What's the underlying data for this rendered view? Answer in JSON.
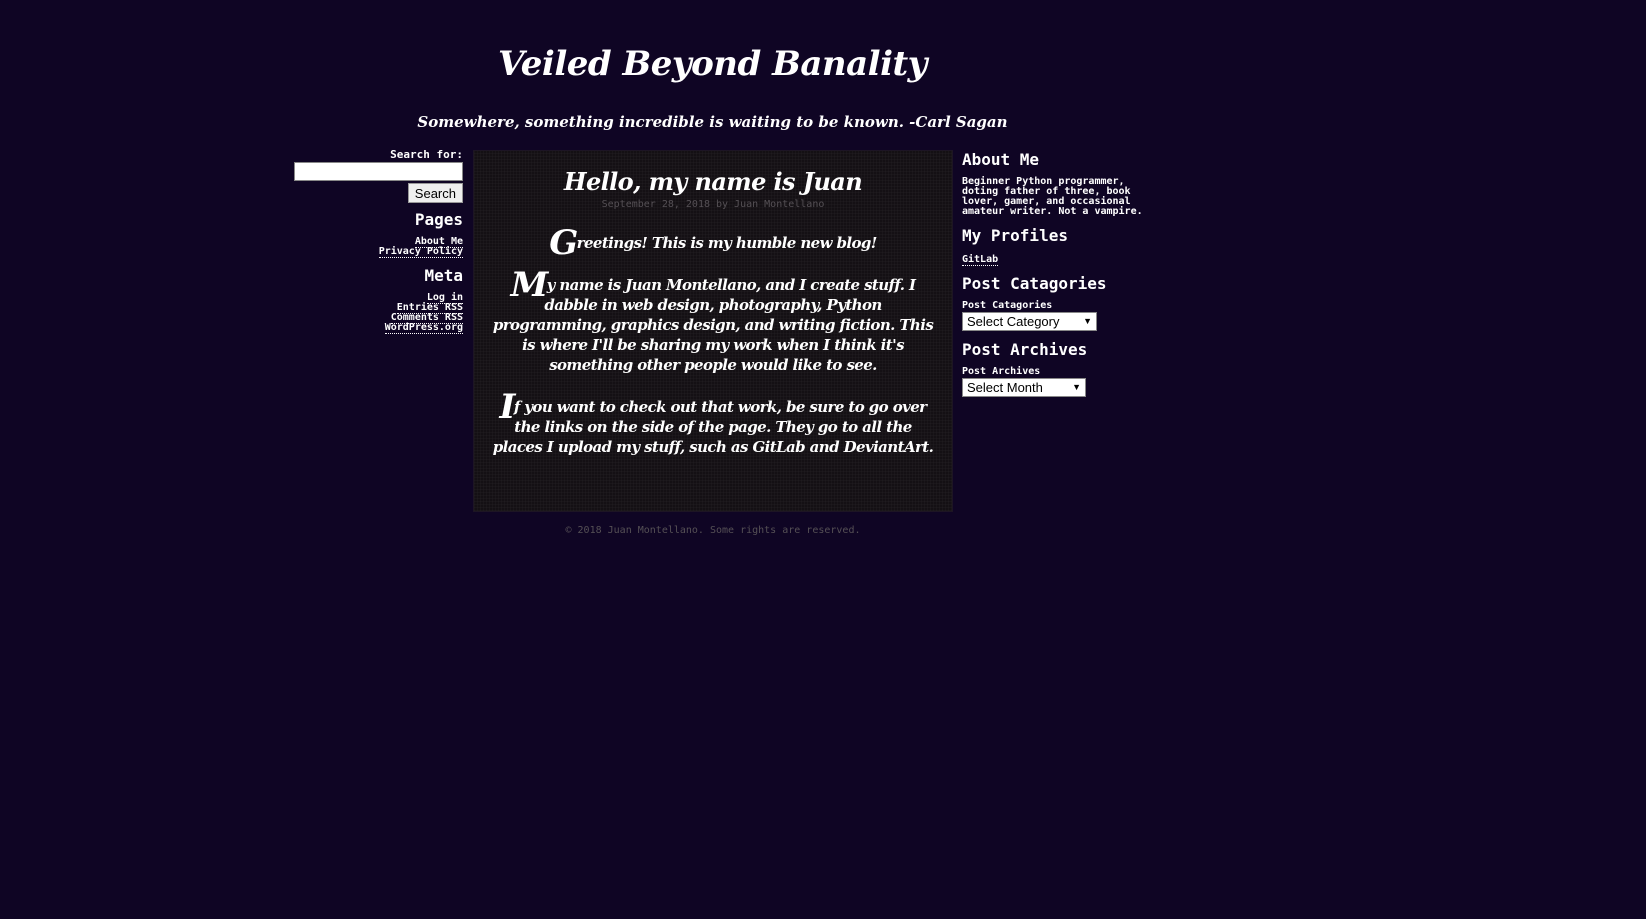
{
  "header": {
    "title": "Veiled Beyond Banality",
    "tagline": "Somewhere, something incredible is waiting to be known. -Carl Sagan"
  },
  "left_sidebar": {
    "search": {
      "label": "Search for:",
      "value": "",
      "placeholder": "",
      "button_label": "Search"
    },
    "pages": {
      "title": "Pages",
      "links": [
        "About Me",
        "Privacy Policy"
      ]
    },
    "meta": {
      "title": "Meta",
      "links": [
        "Log in",
        "Entries RSS",
        "Comments RSS",
        "WordPress.org"
      ]
    }
  },
  "post": {
    "title": "Hello, my name is Juan",
    "meta": "September 28, 2018 by Juan Montellano",
    "paragraphs": [
      {
        "dropcap": "G",
        "text": "reetings! This is my humble new blog!"
      },
      {
        "dropcap": "M",
        "text": "y name is Juan Montellano, and I create stuff. I dabble in web design, photography, Python programming, graphics design, and writing fiction. This is where I'll be sharing my work when I think it's something other people would like to see."
      },
      {
        "dropcap": "I",
        "text": "f you want to check out that work, be sure to go over the links on the side of the page. They go to all the places I upload my stuff, such as GitLab and DeviantArt."
      }
    ]
  },
  "footer": {
    "text": "© 2018 Juan Montellano. Some rights are reserved."
  },
  "right_sidebar": {
    "about": {
      "title": "About Me",
      "text": "Beginner Python programmer, doting father of three, book lover, gamer, and occasional amateur writer. Not a vampire."
    },
    "profiles": {
      "title": "My Profiles",
      "links": [
        "GitLab"
      ]
    },
    "categories": {
      "title": "Post Catagories",
      "label": "Post Catagories",
      "selected": "Select Category"
    },
    "archives": {
      "title": "Post Archives",
      "label": "Post Archives",
      "selected": "Select Month"
    }
  },
  "colors": {
    "background": "#0f0524",
    "post_background": "#141014",
    "text": "#ffffff",
    "muted_text": "#555055"
  }
}
